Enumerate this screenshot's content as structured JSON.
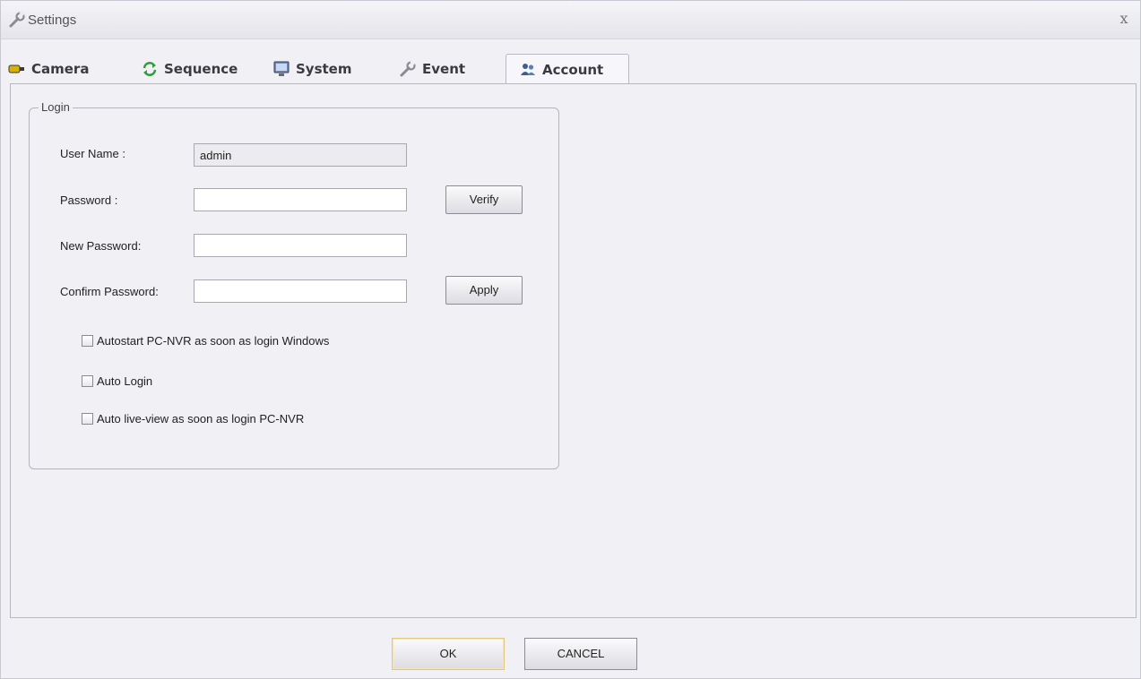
{
  "window": {
    "title": "Settings",
    "close_glyph": "x"
  },
  "tabs": [
    {
      "label": "Camera",
      "icon": "camera-icon"
    },
    {
      "label": "Sequence",
      "icon": "sequence-icon"
    },
    {
      "label": "System",
      "icon": "monitor-icon"
    },
    {
      "label": "Event",
      "icon": "wrench-icon"
    },
    {
      "label": "Account",
      "icon": "users-icon",
      "active": true
    }
  ],
  "login": {
    "group_label": "Login",
    "username_label": "User Name :",
    "username_value": "admin",
    "password_label": "Password :",
    "password_value": "",
    "new_password_label": "New Password:",
    "new_password_value": "",
    "confirm_password_label": "Confirm Password:",
    "confirm_password_value": "",
    "verify_label": "Verify",
    "apply_label": "Apply",
    "options": [
      {
        "label": "Autostart PC-NVR as soon as login Windows",
        "checked": false
      },
      {
        "label": "Auto Login",
        "checked": false
      },
      {
        "label": "Auto live-view as soon as login PC-NVR",
        "checked": false
      }
    ]
  },
  "footer": {
    "ok_label": "OK",
    "cancel_label": "CANCEL"
  },
  "colors": {
    "background": "#f0f0f5",
    "border": "#b8b8c4",
    "default_button_border": "#e3c77a"
  }
}
